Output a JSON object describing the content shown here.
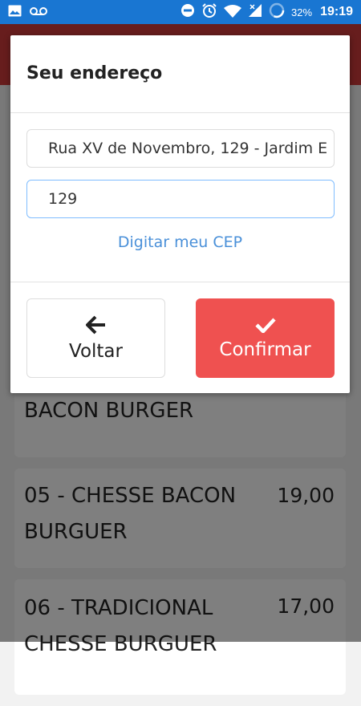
{
  "status_bar": {
    "battery": "32%",
    "time": "19:19",
    "icons": [
      "image-icon",
      "voicemail-icon",
      "do-not-disturb-icon",
      "alarm-icon",
      "wifi-icon",
      "signal-icon",
      "battery-icon"
    ]
  },
  "modal": {
    "title": "Seu endereço",
    "address_value": "Rua XV de Novembro, 129 - Jardim E",
    "number_value": "129",
    "cep_link": "Digitar meu CEP",
    "back_label": "Voltar",
    "confirm_label": "Confirmar",
    "back_icon": "arrow-left-icon",
    "confirm_icon": "check-icon",
    "confirm_color": "#ef5150"
  },
  "menu_items": [
    {
      "name": "BACON BURGER",
      "price": ""
    },
    {
      "name": "05 - CHESSE BACON BURGUER",
      "price": "19,00"
    },
    {
      "name": "06 - TRADICIONAL CHESSE BURGUER",
      "price": "17,00"
    }
  ],
  "colors": {
    "status_bar": "#1976d2",
    "app_bar": "#cf3a3a",
    "link": "#4a90d9"
  }
}
